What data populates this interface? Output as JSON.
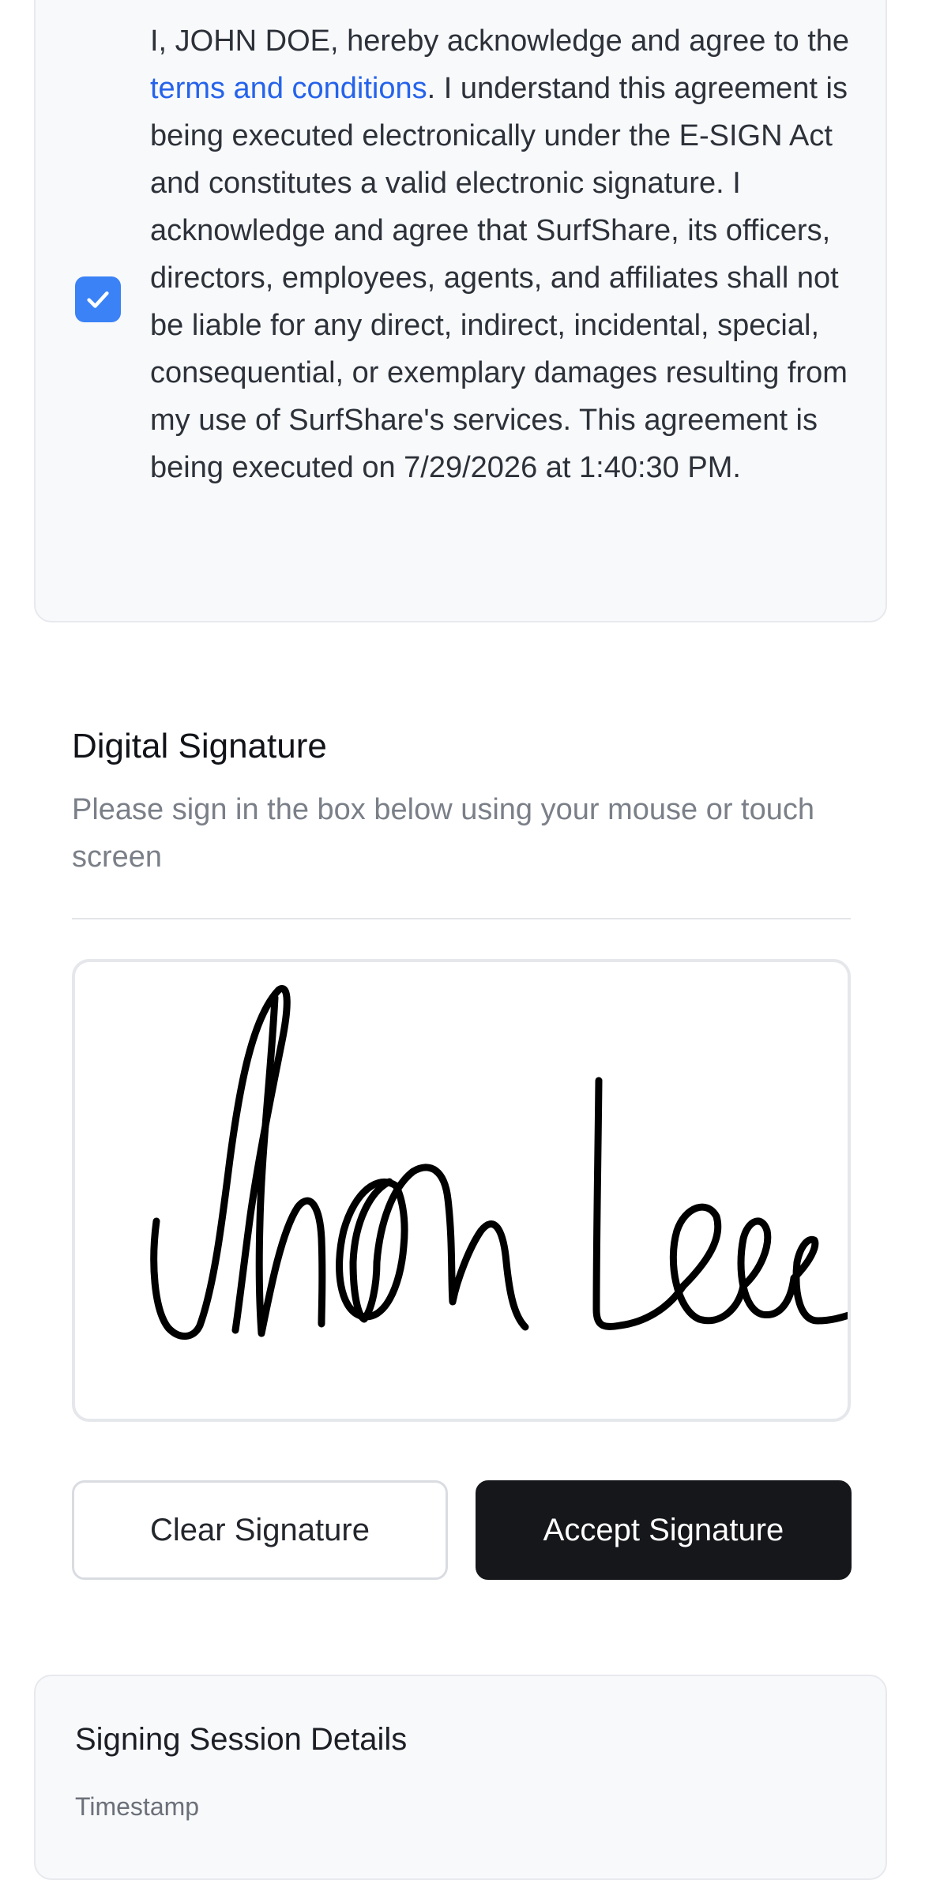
{
  "agreement": {
    "checked": true,
    "text_before_link": "I, JOHN DOE, hereby acknowledge and agree to the ",
    "link_text": "terms and conditions",
    "text_after_link": ". I understand this agreement is being executed electronically under the E-SIGN Act and constitutes a valid electronic signature. I acknowledge and agree that SurfShare, its officers, directors, employees, agents, and affiliates shall not be liable for any direct, indirect, incidental, special, consequential, or exemplary damages resulting from my use of SurfShare's services. This agreement is being executed on 7/29/2026 at 1:40:30 PM."
  },
  "signature": {
    "title": "Digital Signature",
    "subtitle": "Please sign in the box below using your mouse or touch screen",
    "clear_label": "Clear Signature",
    "accept_label": "Accept Signature"
  },
  "session": {
    "title": "Signing Session Details",
    "timestamp_label": "Timestamp"
  },
  "colors": {
    "accent": "#3b82f6",
    "link": "#2563eb",
    "primary_button": "#16171a"
  }
}
